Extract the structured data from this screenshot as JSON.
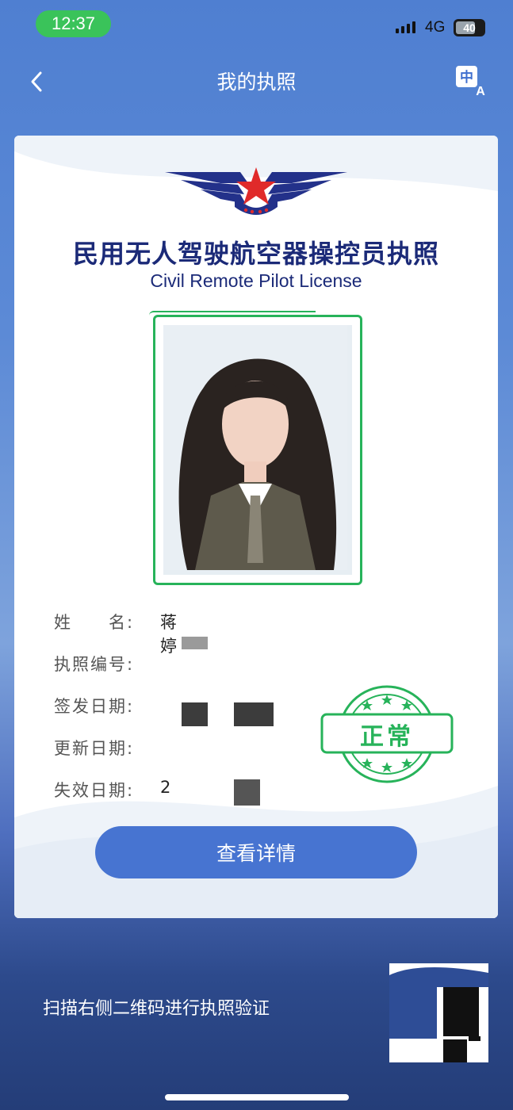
{
  "status": {
    "time": "12:37",
    "network": "4G",
    "battery": "40"
  },
  "nav": {
    "title": "我的执照"
  },
  "license": {
    "title_cn": "民用无人驾驶航空器操控员执照",
    "title_en": "Civil Remote Pilot License",
    "fields": [
      {
        "label": "姓　　名:",
        "value": "蒋婷"
      },
      {
        "label": "执照编号:",
        "value": ""
      },
      {
        "label": "签发日期:",
        "value": ""
      },
      {
        "label": "更新日期:",
        "value": ""
      },
      {
        "label": "失效日期:",
        "value": "2"
      }
    ],
    "status_stamp": "正常",
    "detail_button": "查看详情"
  },
  "scan": {
    "text": "扫描右侧二维码进行执照验证"
  },
  "colors": {
    "brand_blue": "#4774d1",
    "title_navy": "#1b2a78",
    "stamp_green": "#27b35a"
  }
}
